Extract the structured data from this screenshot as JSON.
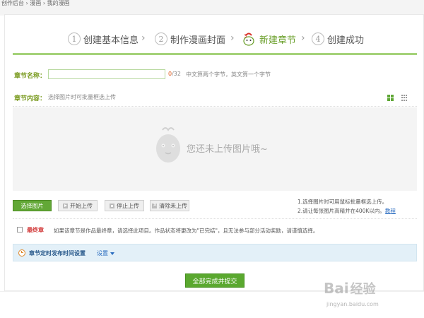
{
  "breadcrumb": "创作后台 › 漫画 › 我的漫画",
  "steps": [
    {
      "num": "1",
      "label": "创建基本信息",
      "active": false
    },
    {
      "num": "2",
      "label": "制作漫画封面",
      "active": false
    },
    {
      "num": "3",
      "label": "新建章节",
      "active": true
    },
    {
      "num": "4",
      "label": "创建成功",
      "active": false
    }
  ],
  "chapter_name": {
    "label": "章节名称：",
    "value": "",
    "count_current": "0",
    "count_max": "/32",
    "hint": "中文算两个字节，英文算一个字节"
  },
  "chapter_content": {
    "label": "章节内容：",
    "hint": "选择图片时可批量框选上传",
    "empty_text": "您还未上传图片哦~"
  },
  "buttons": {
    "select": "选择图片",
    "start": "开始上传",
    "stop": "停止上传",
    "clear": "清除未上传",
    "submit": "全部完成并提交"
  },
  "tips": {
    "line1": "1.选择图片时可用鼠标批量框选上传。",
    "line2": "2.请让每张图片高精并在400K以内。",
    "link": "教程"
  },
  "final": {
    "label": "最终章",
    "desc": "如果该章节是作品最终章，请选择此项目。作品状态将更改为\"已完结\"，且无法参与部分活动奖励，请谨慎选择。"
  },
  "schedule": {
    "title": "章节定时发布时间设置",
    "set": "设置"
  },
  "watermark": {
    "logo": "Bai",
    "logo_cn": "经验",
    "url": "jingyan.baidu.com"
  },
  "colors": {
    "accent_green": "#62a836",
    "label_green": "#7a9b20",
    "active_step": "#6a9f2a",
    "final_red": "#d23a3a",
    "link_blue": "#2a6cc0"
  }
}
